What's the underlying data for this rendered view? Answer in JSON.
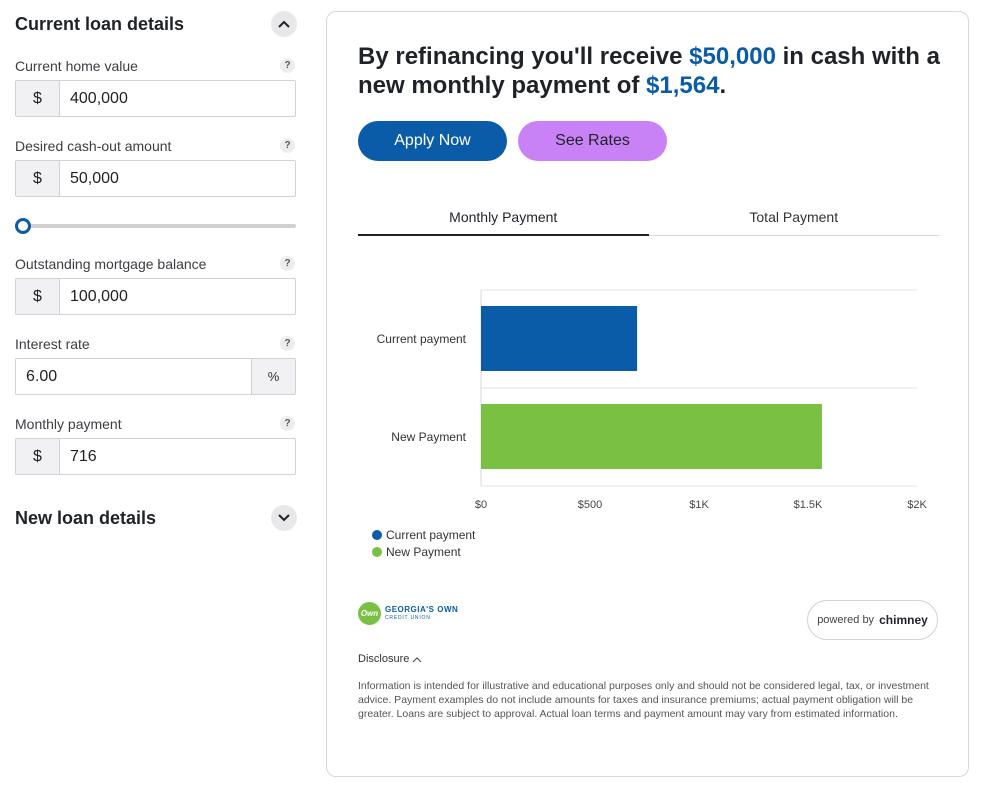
{
  "left": {
    "current_loan": {
      "title": "Current loan details",
      "fields": {
        "home_value": {
          "label": "Current home value",
          "prefix": "$",
          "value": "400,000"
        },
        "cash_out": {
          "label": "Desired cash-out amount",
          "prefix": "$",
          "value": "50,000"
        },
        "mortgage_balance": {
          "label": "Outstanding mortgage balance",
          "prefix": "$",
          "value": "100,000"
        },
        "interest_rate": {
          "label": "Interest rate",
          "suffix": "%",
          "value": "6.00"
        },
        "monthly_payment": {
          "label": "Monthly payment",
          "prefix": "$",
          "value": "716"
        }
      },
      "help": "?",
      "slider_fraction": 0.03
    },
    "new_loan": {
      "title": "New loan details"
    }
  },
  "card": {
    "headline": {
      "part1": "By refinancing you'll receive ",
      "cash": "$50,000",
      "part2": " in cash with a new monthly payment of ",
      "payment": "$1,564",
      "part3": "."
    },
    "buttons": {
      "apply": "Apply Now",
      "rates": "See Rates"
    },
    "tabs": [
      "Monthly Payment",
      "Total Payment"
    ],
    "logo": {
      "badge": "Own",
      "main": "GEORGIA'S OWN",
      "sub": "CREDIT UNION"
    },
    "powered": {
      "prefix": "powered by",
      "brand": "chimney"
    },
    "disclosure": {
      "label": "Disclosure",
      "text": "Information is intended for illustrative and educational purposes only and should not be considered legal, tax, or investment advice. Payment examples do not include amounts for taxes and insurance premiums; actual payment obligation will be greater. Loans are subject to approval. Actual loan terms and payment amount may vary from estimated information."
    }
  },
  "colors": {
    "brand_blue": "#0a5ca8",
    "green": "#7ac143",
    "purple": "#c982f5"
  },
  "chart_data": {
    "type": "bar",
    "orientation": "horizontal",
    "categories": [
      "Current payment",
      "New Payment"
    ],
    "values": [
      716,
      1564
    ],
    "colors": [
      "#0a5ca8",
      "#7ac143"
    ],
    "xlim": [
      0,
      2000
    ],
    "ticks": [
      0,
      500,
      1000,
      1500,
      2000
    ],
    "tick_labels": [
      "$0",
      "$500",
      "$1K",
      "$1.5K",
      "$2K"
    ],
    "legend": [
      "Current payment",
      "New Payment"
    ],
    "legend_position": "bottom-left",
    "grid": true
  }
}
